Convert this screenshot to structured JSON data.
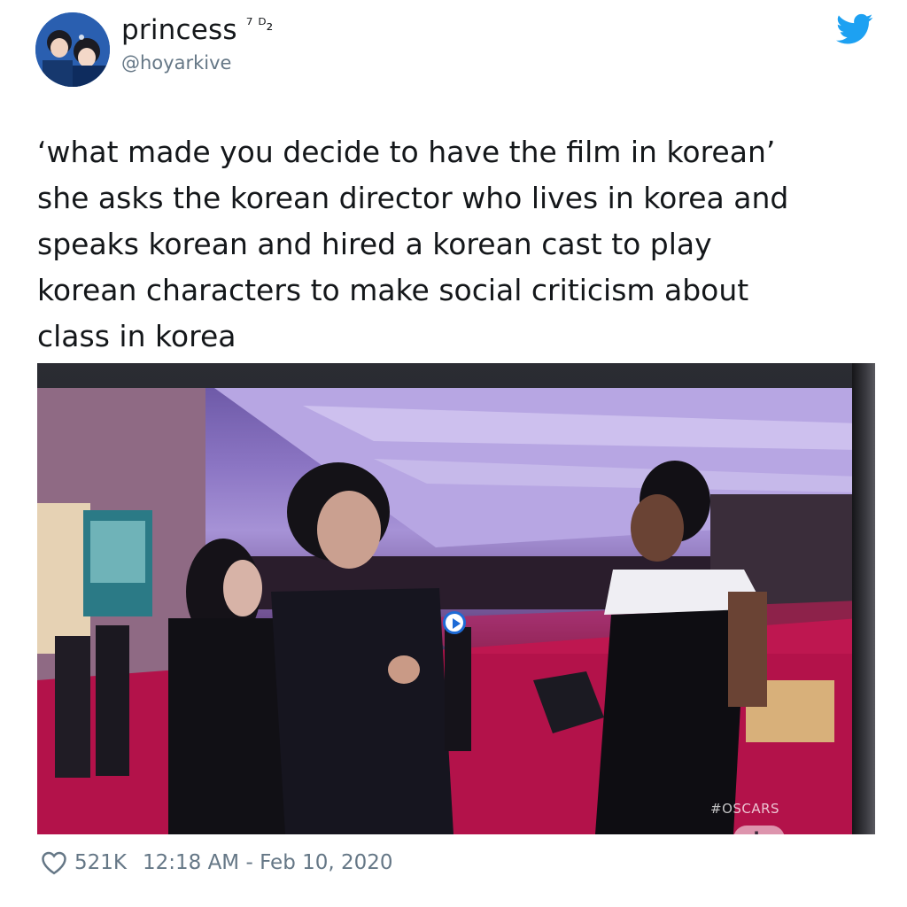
{
  "tweet": {
    "author": {
      "display_name": "princess",
      "name_badge": "⁷ ᴰ₂",
      "handle": "@hoyarkive",
      "avatar_icon": "avatar-photo"
    },
    "platform_icon": "twitter-bird-icon",
    "text_lines": [
      "‘what made you decide to have the film in korean’",
      "she asks the korean director who lives in korea and",
      "speaks korean and hired a korean cast to play",
      "korean characters to make social criticism about",
      "class in korea"
    ],
    "media": {
      "type": "photo",
      "overlay_hashtag": "#OSCARS",
      "overlay_logo": "abc"
    },
    "footer": {
      "like_icon": "heart-icon",
      "likes": "521K",
      "timestamp": "12:18 AM - Feb 10, 2020"
    }
  },
  "colors": {
    "text": "#14171a",
    "secondary_text": "#657786",
    "twitter_blue": "#1da1f2",
    "carpet_red": "#b3124a"
  }
}
